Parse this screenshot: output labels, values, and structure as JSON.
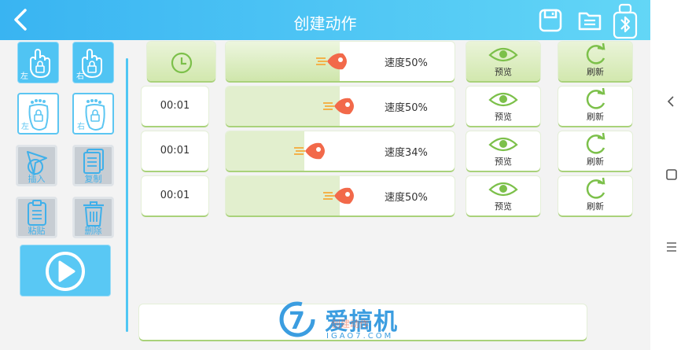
{
  "header": {
    "title": "创建动作",
    "back_icon": "chevron-left-icon",
    "save_icon": "save-icon",
    "folder_icon": "folder-icon",
    "bluetooth_icon": "bluetooth-robot-icon"
  },
  "tools": {
    "hand_left": "左",
    "hand_right": "右",
    "foot_left": "左",
    "foot_right": "右",
    "insert": "插入",
    "copy": "复制",
    "paste": "粘贴",
    "delete": "删除"
  },
  "rows": [
    {
      "time": "",
      "speed": "速度50%",
      "speed_pct": 50,
      "preview": "预览",
      "refresh": "刷新",
      "header": true
    },
    {
      "time": "00:01",
      "speed": "速度50%",
      "speed_pct": 50,
      "preview": "预览",
      "refresh": "刷新"
    },
    {
      "time": "00:01",
      "speed": "速度34%",
      "speed_pct": 34,
      "preview": "预览",
      "refresh": "刷新"
    },
    {
      "time": "00:01",
      "speed": "速度50%",
      "speed_pct": 50,
      "preview": "预览",
      "refresh": "刷新"
    }
  ],
  "watermark": {
    "brand": "爱搞机",
    "domain": "IGAO7.COM",
    "overlay": "创建动作"
  },
  "colors": {
    "header_start": "#39b4f2",
    "header_end": "#63d6f6",
    "accent_green": "#7cc04a",
    "accent_blue": "#4fc6f3"
  }
}
